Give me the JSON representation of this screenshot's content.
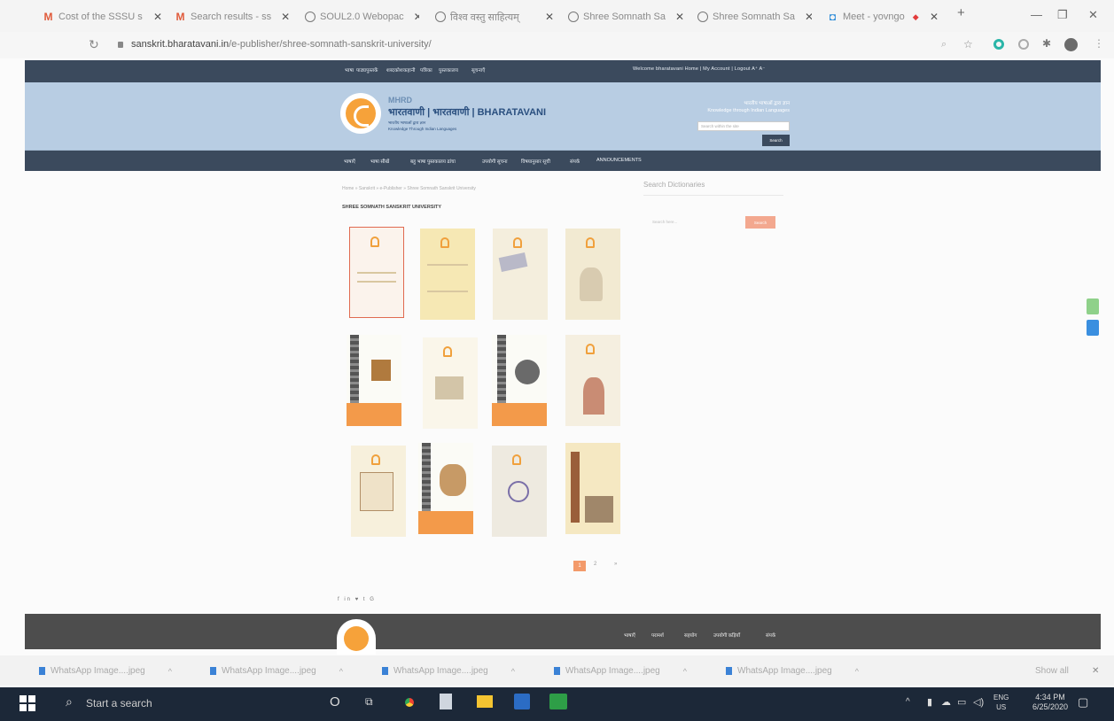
{
  "browser": {
    "tabs": [
      {
        "icon": "gmail-icon",
        "title": "Cost of the SSSU s"
      },
      {
        "icon": "gmail-icon",
        "title": "Search results - ss"
      },
      {
        "icon": "globe-icon",
        "title": "SOUL2.0 Webopac"
      },
      {
        "icon": "globe-icon",
        "title": "विश्व वस्तु साहित्यम्"
      },
      {
        "icon": "globe-icon",
        "title": "Shree Somnath Sa"
      },
      {
        "icon": "globe-icon",
        "title": "Shree Somnath Sa"
      },
      {
        "icon": "meet-icon",
        "title": "Meet - yovngo"
      }
    ],
    "new_tab": "+",
    "url_host": "sanskrit.bharatavani.in",
    "url_path": "/e-publisher/shree-somnath-sanskrit-university/"
  },
  "site": {
    "top_nav": [
      "भाषा",
      "पाठ्यपुस्तकें",
      "शब्दकोश",
      "कहानी",
      "पत्रिका",
      "पुस्तकालय",
      "सूचनाएँ"
    ],
    "top_right": "Welcome bharatavani  Home | My Account | Logout  A⁺ A⁻",
    "mhrd": "MHRD",
    "brand": "भारतवाणी | भारतवाणी | BHARATAVANI",
    "subline1": "भारतीय भाषाओं द्वारा ज्ञान",
    "subline2": "Knowledge Through Indian Languages",
    "tagline1": "भारतीय भाषाओं द्वारा ज्ञान",
    "tagline2": "Knowledge through Indian Languages",
    "search_placeholder": "Search within the site",
    "search_button": "Search",
    "menu": [
      "भाषाएँ",
      "भाषा सीखें",
      "बहु भाषा पुस्तकालय ढांचा",
      "उपयोगी सूचना",
      "विषयानुसार सूची",
      "संपर्क",
      "ANNOUNCEMENTS"
    ],
    "breadcrumb": "Home » Sanskrit » e-Publisher » Shree Somnath Sanskrit University",
    "page_title": "SHREE SOMNATH SANSKRIT UNIVERSITY",
    "sidebar_heading": "Search Dictionaries",
    "sidebar_placeholder": "Search here...",
    "sidebar_button": "Search",
    "pagination": [
      "1",
      "2",
      "»"
    ],
    "social": "f in ♥ t G",
    "footer_menu": [
      "भाषाएँ",
      "परामर्श",
      "सहयोग",
      "उपयोगी कड़ियाँ",
      "संपर्क"
    ]
  },
  "downloads": {
    "items": [
      "WhatsApp Image....jpeg",
      "WhatsApp Image....jpeg",
      "WhatsApp Image....jpeg",
      "WhatsApp Image....jpeg",
      "WhatsApp Image....jpeg"
    ],
    "show_all": "Show all"
  },
  "taskbar": {
    "search": "Start a search",
    "lang1": "ENG",
    "lang2": "US",
    "time": "4:34 PM",
    "date": "6/25/2020"
  },
  "colors": {
    "site_dark": "#3b4a5d",
    "header_blue": "#b8cde3",
    "accent_orange": "#f39a4a",
    "taskbar": "#1c2838"
  }
}
